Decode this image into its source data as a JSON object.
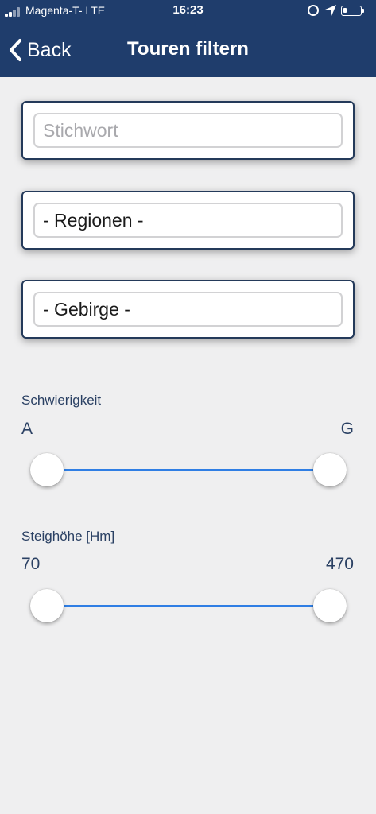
{
  "status_bar": {
    "carrier": "Magenta-T-  LTE",
    "time": "16:23",
    "battery_level": 0.2
  },
  "nav": {
    "back_label": "Back",
    "title": "Touren filtern",
    "back_icon": "chevron-left-icon"
  },
  "filters": {
    "keyword_placeholder": "Stichwort",
    "keyword_value": "",
    "region_selected": "- Regionen -",
    "mountain_selected": "- Gebirge -"
  },
  "difficulty": {
    "label": "Schwierigkeit",
    "min": "A",
    "max": "G",
    "range_low": 0,
    "range_high": 1
  },
  "ascent": {
    "label": "Steighöhe [Hm]",
    "min": "70",
    "max": "470",
    "range_low": 0,
    "range_high": 1
  },
  "colors": {
    "header": "#1f3d6c",
    "accent": "#2f7ee4",
    "label": "#2a4063",
    "background": "#efeff0"
  }
}
